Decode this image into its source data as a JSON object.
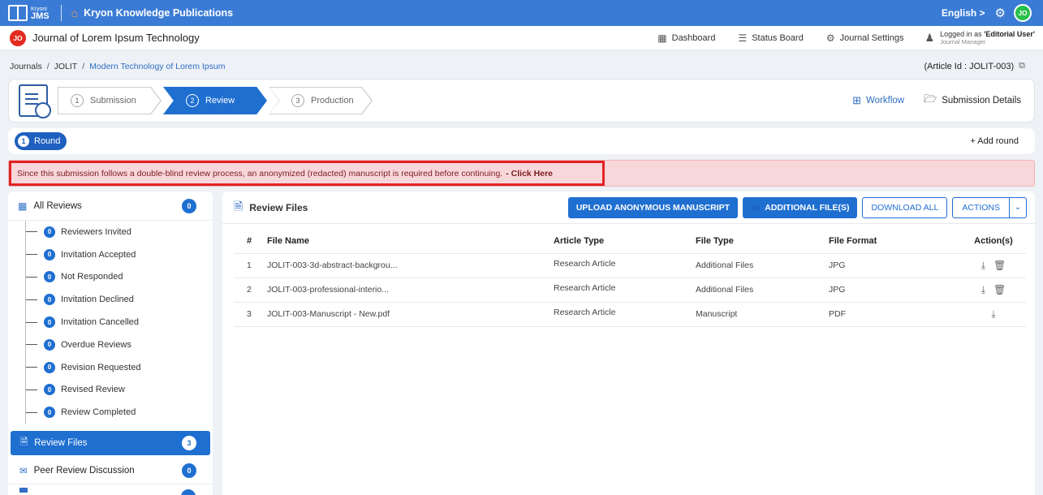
{
  "app": {
    "logo_small": "Kryoni",
    "logo_big": "JMS",
    "publisher": "Kryon Knowledge Publications",
    "language": "English >",
    "user_initials": "JO"
  },
  "journal": {
    "initials": "JO",
    "title": "Journal of Lorem Ipsum Technology"
  },
  "nav": {
    "dashboard": "Dashboard",
    "status_board": "Status Board",
    "journal_settings": "Journal Settings",
    "logged_prefix": "Logged in as",
    "logged_role": "'Editorial User'",
    "logged_sub": "Journal Manager"
  },
  "breadcrumb": {
    "items": [
      "Journals",
      "JOLIT",
      "Modern Technology of Lorem Ipsum"
    ],
    "separator": "/"
  },
  "article_id": "(Article Id : JOLIT-003)",
  "stepper": {
    "steps": [
      {
        "num": "1",
        "label": "Submission"
      },
      {
        "num": "2",
        "label": "Review"
      },
      {
        "num": "3",
        "label": "Production"
      }
    ],
    "active_index": 1,
    "workflow": "Workflow",
    "submission_details": "Submission Details"
  },
  "round": {
    "num": "1",
    "label": "Round",
    "add_round": "+ Add round"
  },
  "alert": {
    "text": "Since this submission follows a double-blind review process, an anonymized (redacted) manuscript is required before continuing.",
    "link": "- Click Here"
  },
  "sidebar": {
    "all_reviews": {
      "label": "All Reviews",
      "count": "0"
    },
    "items": [
      {
        "label": "Reviewers Invited",
        "count": "0"
      },
      {
        "label": "Invitation Accepted",
        "count": "0"
      },
      {
        "label": "Not Responded",
        "count": "0"
      },
      {
        "label": "Invitation Declined",
        "count": "0"
      },
      {
        "label": "Invitation Cancelled",
        "count": "0"
      },
      {
        "label": "Overdue Reviews",
        "count": "0"
      },
      {
        "label": "Revision Requested",
        "count": "0"
      },
      {
        "label": "Revised Review",
        "count": "0"
      },
      {
        "label": "Review Completed",
        "count": "0"
      }
    ],
    "review_files": {
      "label": "Review Files",
      "count": "3"
    },
    "peer_review": {
      "label": "Peer Review Discussion",
      "count": "0"
    }
  },
  "main": {
    "title": "Review Files",
    "buttons": {
      "upload_anon": "UPLOAD ANONYMOUS MANUSCRIPT",
      "additional": "ADDITIONAL FILE(S)",
      "download_all": "DOWNLOAD ALL",
      "actions": "ACTIONS"
    },
    "columns": [
      "#",
      "File Name",
      "Article Type",
      "File Type",
      "File Format",
      "Action(s)"
    ],
    "rows": [
      {
        "num": "1",
        "name": "JOLIT-003-3d-abstract-backgrou...",
        "article_type": "Research Article",
        "file_type": "Additional Files",
        "format": "JPG",
        "deletable": true
      },
      {
        "num": "2",
        "name": "JOLIT-003-professional-interio...",
        "article_type": "Research Article",
        "file_type": "Additional Files",
        "format": "JPG",
        "deletable": true
      },
      {
        "num": "3",
        "name": "JOLIT-003-Manuscript - New.pdf",
        "article_type": "Research Article",
        "file_type": "Manuscript",
        "format": "PDF",
        "deletable": false
      }
    ]
  }
}
